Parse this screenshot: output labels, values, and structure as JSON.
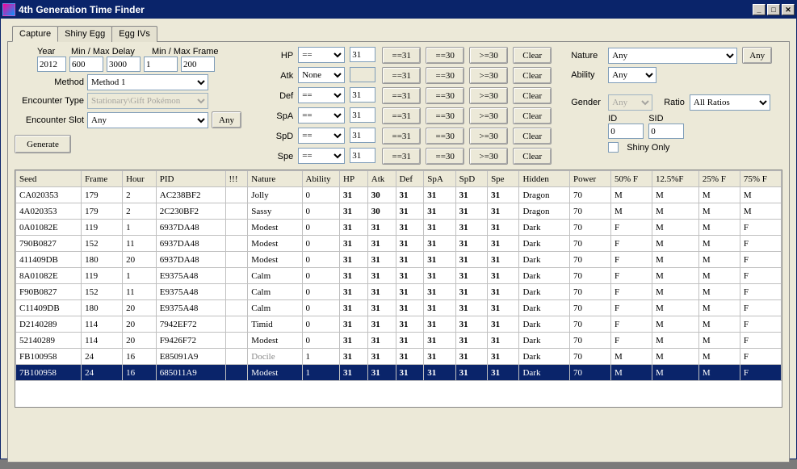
{
  "window": {
    "title": "4th Generation Time Finder"
  },
  "tabs": [
    "Capture",
    "Shiny Egg",
    "Egg IVs"
  ],
  "activeTab": 0,
  "labels": {
    "year": "Year",
    "minMaxDelay": "Min / Max Delay",
    "minMaxFrame": "Min / Max Frame",
    "method": "Method",
    "encounterType": "Encounter Type",
    "encounterSlot": "Encounter Slot",
    "nature": "Nature",
    "ability": "Ability",
    "gender": "Gender",
    "ratio": "Ratio",
    "id": "ID",
    "sid": "SID",
    "shinyOnly": "Shiny Only",
    "generate": "Generate",
    "anyBtn": "Any"
  },
  "inputs": {
    "year": "2012",
    "delayMin": "600",
    "delayMax": "3000",
    "frameMin": "1",
    "frameMax": "200",
    "method": "Method 1",
    "encounterType": "Stationary\\Gift Pokémon",
    "encounterSlot": "Any",
    "nature": "Any",
    "ability": "Any",
    "gender": "Any",
    "ratio": "All Ratios",
    "id": "0",
    "sid": "0"
  },
  "ivRows": [
    {
      "name": "HP",
      "cmp": "==",
      "val": "31"
    },
    {
      "name": "Atk",
      "cmp": "None",
      "val": ""
    },
    {
      "name": "Def",
      "cmp": "==",
      "val": "31"
    },
    {
      "name": "SpA",
      "cmp": "==",
      "val": "31"
    },
    {
      "name": "SpD",
      "cmp": "==",
      "val": "31"
    },
    {
      "name": "Spe",
      "cmp": "==",
      "val": "31"
    }
  ],
  "ivButtons": {
    "eq31": "==31",
    "eq30": "==30",
    "ge30": ">=30",
    "clear": "Clear"
  },
  "columns": [
    "Seed",
    "Frame",
    "Hour",
    "PID",
    "!!!",
    "Nature",
    "Ability",
    "HP",
    "Atk",
    "Def",
    "SpA",
    "SpD",
    "Spe",
    "Hidden",
    "Power",
    "50% F",
    "12.5%F",
    "25% F",
    "75% F"
  ],
  "rows": [
    {
      "seed": "CA020353",
      "frame": "179",
      "hour": "2",
      "pid": "AC238BF2",
      "ex": "",
      "nature": "Jolly",
      "ability": "0",
      "hp": "31",
      "atk": "30",
      "def": "31",
      "spa": "31",
      "spd": "31",
      "spe": "31",
      "hidden": "Dragon",
      "power": "70",
      "f50": "M",
      "f125": "M",
      "f25": "M",
      "f75": "M",
      "gray": false,
      "sel": false
    },
    {
      "seed": "4A020353",
      "frame": "179",
      "hour": "2",
      "pid": "2C230BF2",
      "ex": "",
      "nature": "Sassy",
      "ability": "0",
      "hp": "31",
      "atk": "30",
      "def": "31",
      "spa": "31",
      "spd": "31",
      "spe": "31",
      "hidden": "Dragon",
      "power": "70",
      "f50": "M",
      "f125": "M",
      "f25": "M",
      "f75": "M",
      "gray": false,
      "sel": false
    },
    {
      "seed": "0A01082E",
      "frame": "119",
      "hour": "1",
      "pid": "6937DA48",
      "ex": "",
      "nature": "Modest",
      "ability": "0",
      "hp": "31",
      "atk": "31",
      "def": "31",
      "spa": "31",
      "spd": "31",
      "spe": "31",
      "hidden": "Dark",
      "power": "70",
      "f50": "F",
      "f125": "M",
      "f25": "M",
      "f75": "F",
      "gray": false,
      "sel": false
    },
    {
      "seed": "790B0827",
      "frame": "152",
      "hour": "11",
      "pid": "6937DA48",
      "ex": "",
      "nature": "Modest",
      "ability": "0",
      "hp": "31",
      "atk": "31",
      "def": "31",
      "spa": "31",
      "spd": "31",
      "spe": "31",
      "hidden": "Dark",
      "power": "70",
      "f50": "F",
      "f125": "M",
      "f25": "M",
      "f75": "F",
      "gray": false,
      "sel": false
    },
    {
      "seed": "411409DB",
      "frame": "180",
      "hour": "20",
      "pid": "6937DA48",
      "ex": "",
      "nature": "Modest",
      "ability": "0",
      "hp": "31",
      "atk": "31",
      "def": "31",
      "spa": "31",
      "spd": "31",
      "spe": "31",
      "hidden": "Dark",
      "power": "70",
      "f50": "F",
      "f125": "M",
      "f25": "M",
      "f75": "F",
      "gray": false,
      "sel": false
    },
    {
      "seed": "8A01082E",
      "frame": "119",
      "hour": "1",
      "pid": "E9375A48",
      "ex": "",
      "nature": "Calm",
      "ability": "0",
      "hp": "31",
      "atk": "31",
      "def": "31",
      "spa": "31",
      "spd": "31",
      "spe": "31",
      "hidden": "Dark",
      "power": "70",
      "f50": "F",
      "f125": "M",
      "f25": "M",
      "f75": "F",
      "gray": false,
      "sel": false
    },
    {
      "seed": "F90B0827",
      "frame": "152",
      "hour": "11",
      "pid": "E9375A48",
      "ex": "",
      "nature": "Calm",
      "ability": "0",
      "hp": "31",
      "atk": "31",
      "def": "31",
      "spa": "31",
      "spd": "31",
      "spe": "31",
      "hidden": "Dark",
      "power": "70",
      "f50": "F",
      "f125": "M",
      "f25": "M",
      "f75": "F",
      "gray": false,
      "sel": false
    },
    {
      "seed": "C11409DB",
      "frame": "180",
      "hour": "20",
      "pid": "E9375A48",
      "ex": "",
      "nature": "Calm",
      "ability": "0",
      "hp": "31",
      "atk": "31",
      "def": "31",
      "spa": "31",
      "spd": "31",
      "spe": "31",
      "hidden": "Dark",
      "power": "70",
      "f50": "F",
      "f125": "M",
      "f25": "M",
      "f75": "F",
      "gray": false,
      "sel": false
    },
    {
      "seed": "D2140289",
      "frame": "114",
      "hour": "20",
      "pid": "7942EF72",
      "ex": "",
      "nature": "Timid",
      "ability": "0",
      "hp": "31",
      "atk": "31",
      "def": "31",
      "spa": "31",
      "spd": "31",
      "spe": "31",
      "hidden": "Dark",
      "power": "70",
      "f50": "F",
      "f125": "M",
      "f25": "M",
      "f75": "F",
      "gray": false,
      "sel": false
    },
    {
      "seed": "52140289",
      "frame": "114",
      "hour": "20",
      "pid": "F9426F72",
      "ex": "",
      "nature": "Modest",
      "ability": "0",
      "hp": "31",
      "atk": "31",
      "def": "31",
      "spa": "31",
      "spd": "31",
      "spe": "31",
      "hidden": "Dark",
      "power": "70",
      "f50": "F",
      "f125": "M",
      "f25": "M",
      "f75": "F",
      "gray": false,
      "sel": false
    },
    {
      "seed": "FB100958",
      "frame": "24",
      "hour": "16",
      "pid": "E85091A9",
      "ex": "",
      "nature": "Docile",
      "ability": "1",
      "hp": "31",
      "atk": "31",
      "def": "31",
      "spa": "31",
      "spd": "31",
      "spe": "31",
      "hidden": "Dark",
      "power": "70",
      "f50": "M",
      "f125": "M",
      "f25": "M",
      "f75": "F",
      "gray": true,
      "sel": false
    },
    {
      "seed": "7B100958",
      "frame": "24",
      "hour": "16",
      "pid": "685011A9",
      "ex": "",
      "nature": "Modest",
      "ability": "1",
      "hp": "31",
      "atk": "31",
      "def": "31",
      "spa": "31",
      "spd": "31",
      "spe": "31",
      "hidden": "Dark",
      "power": "70",
      "f50": "M",
      "f125": "M",
      "f25": "M",
      "f75": "F",
      "gray": false,
      "sel": true
    }
  ]
}
